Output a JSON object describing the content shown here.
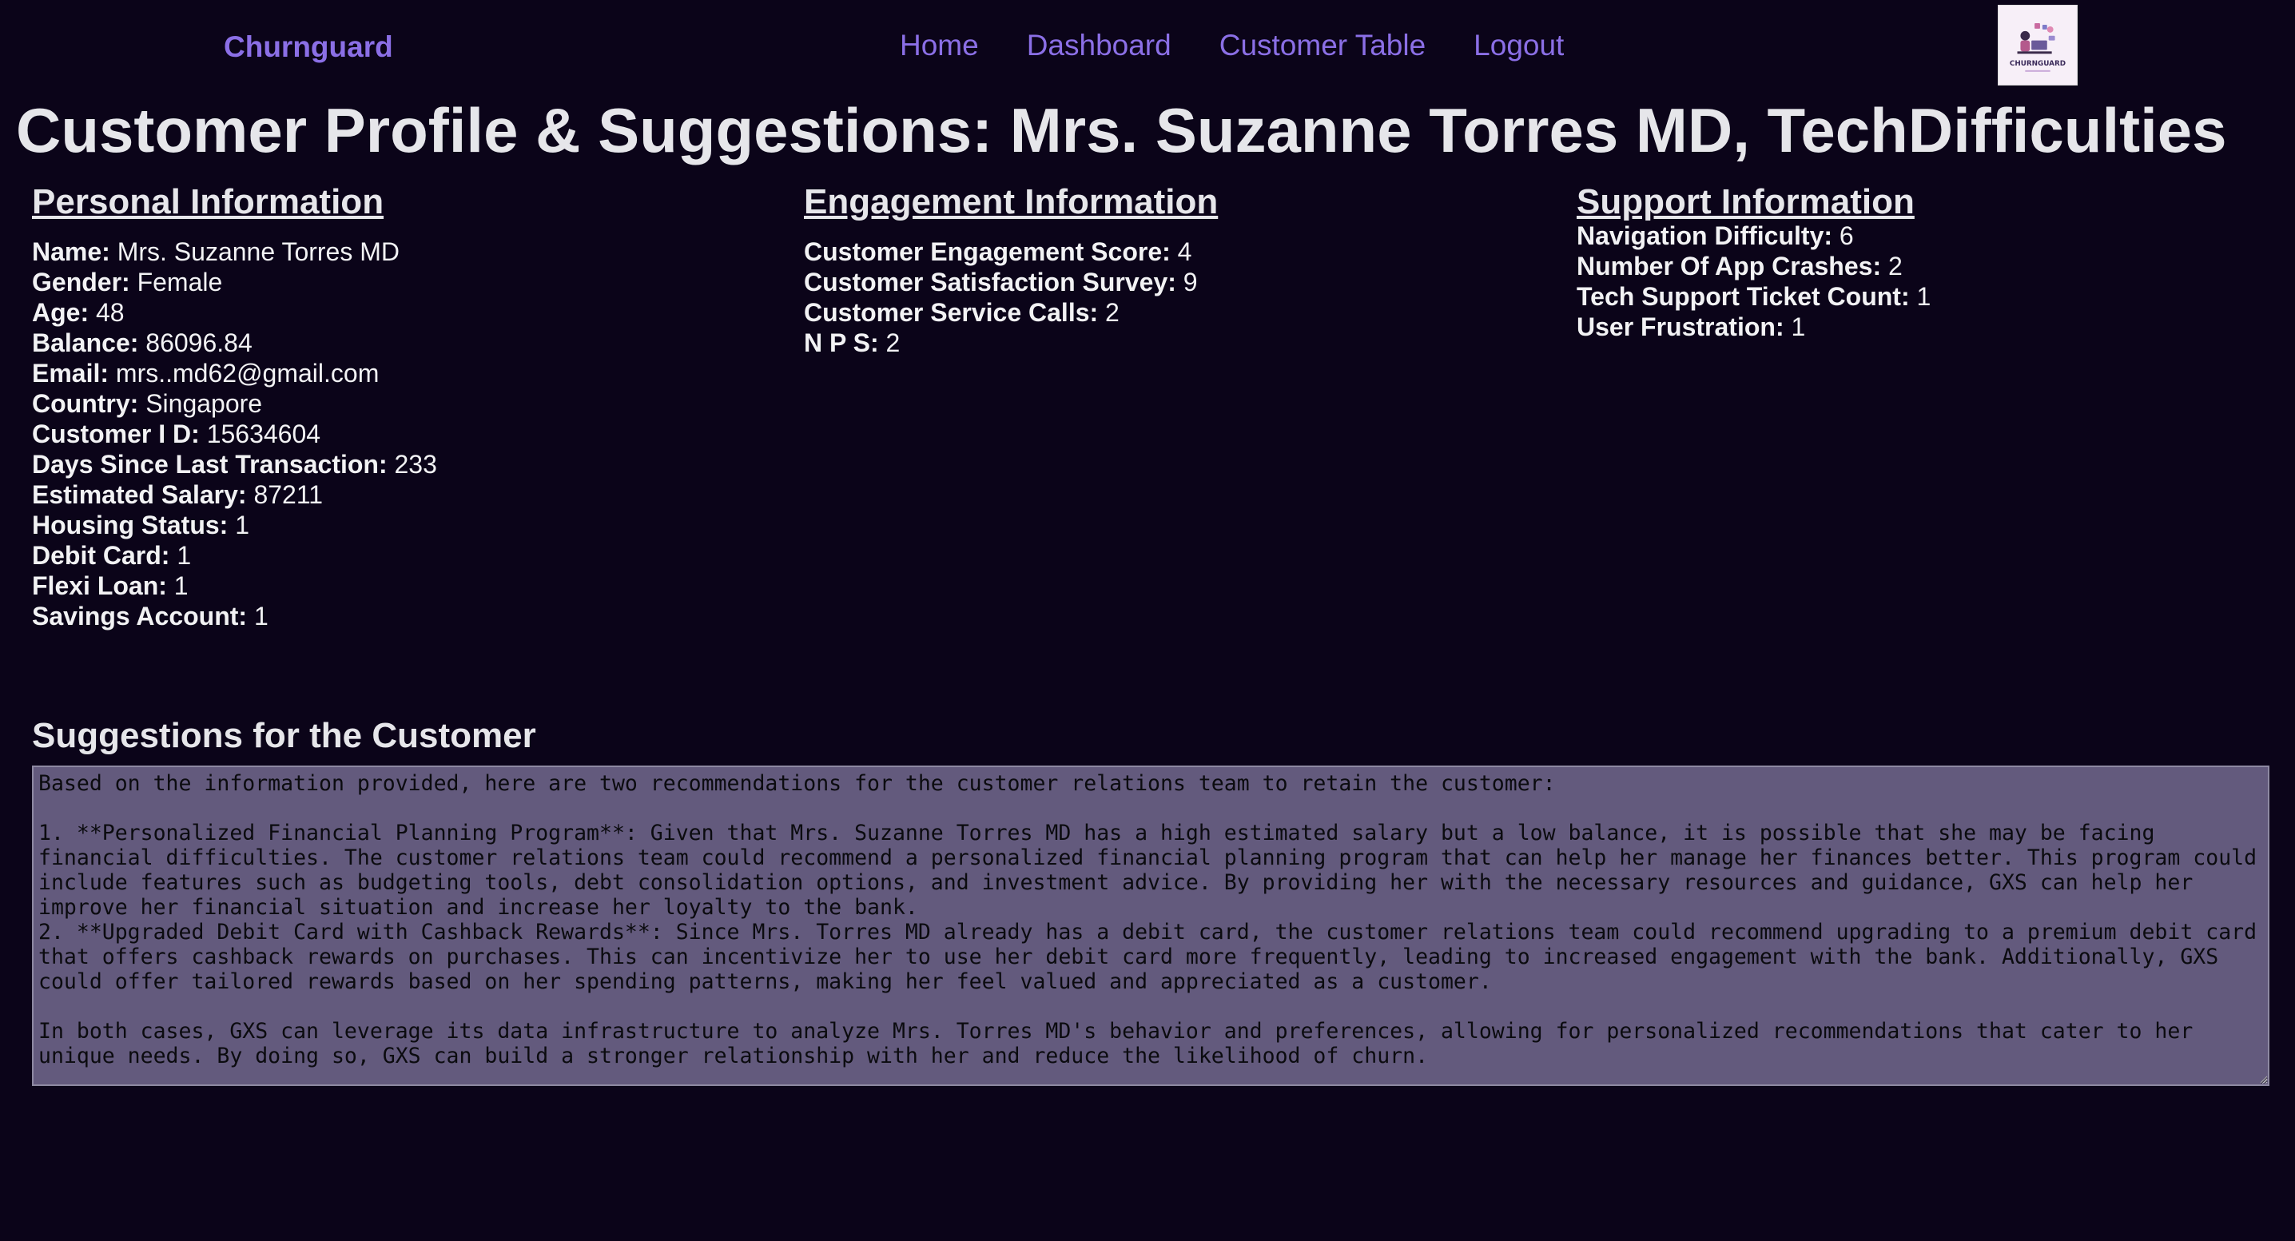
{
  "nav": {
    "brand": "Churnguard",
    "links": [
      "Home",
      "Dashboard",
      "Customer Table",
      "Logout"
    ],
    "logo_text": "CHURNGUARD"
  },
  "page_title": "Customer Profile & Suggestions: Mrs. Suzanne Torres MD, TechDifficulties",
  "personal": {
    "heading": "Personal Information",
    "fields": [
      {
        "label": "Name:",
        "value": "Mrs. Suzanne Torres MD"
      },
      {
        "label": "Gender:",
        "value": "Female"
      },
      {
        "label": "Age:",
        "value": "48"
      },
      {
        "label": "Balance:",
        "value": "86096.84"
      },
      {
        "label": "Email:",
        "value": "mrs..md62@gmail.com"
      },
      {
        "label": "Country:",
        "value": "Singapore"
      },
      {
        "label": "Customer I D:",
        "value": "15634604"
      },
      {
        "label": "Days Since Last Transaction:",
        "value": "233"
      },
      {
        "label": "Estimated Salary:",
        "value": "87211"
      },
      {
        "label": "Housing Status:",
        "value": "1"
      },
      {
        "label": "Debit Card:",
        "value": "1"
      },
      {
        "label": "Flexi Loan:",
        "value": "1"
      },
      {
        "label": "Savings Account:",
        "value": "1"
      }
    ]
  },
  "engagement": {
    "heading": "Engagement Information",
    "fields": [
      {
        "label": "Customer Engagement Score:",
        "value": "4"
      },
      {
        "label": "Customer Satisfaction Survey:",
        "value": "9"
      },
      {
        "label": "Customer Service Calls:",
        "value": "2"
      },
      {
        "label": "N P S:",
        "value": "2"
      }
    ]
  },
  "support": {
    "heading": "Support Information",
    "fields": [
      {
        "label": "Navigation Difficulty:",
        "value": "6"
      },
      {
        "label": "Number Of App Crashes:",
        "value": "2"
      },
      {
        "label": "Tech Support Ticket Count:",
        "value": "1"
      },
      {
        "label": "User Frustration:",
        "value": "1"
      }
    ]
  },
  "suggestions": {
    "heading": "Suggestions for the Customer",
    "text": "Based on the information provided, here are two recommendations for the customer relations team to retain the customer:\n\n1. **Personalized Financial Planning Program**: Given that Mrs. Suzanne Torres MD has a high estimated salary but a low balance, it is possible that she may be facing financial difficulties. The customer relations team could recommend a personalized financial planning program that can help her manage her finances better. This program could include features such as budgeting tools, debt consolidation options, and investment advice. By providing her with the necessary resources and guidance, GXS can help her improve her financial situation and increase her loyalty to the bank.\n2. **Upgraded Debit Card with Cashback Rewards**: Since Mrs. Torres MD already has a debit card, the customer relations team could recommend upgrading to a premium debit card that offers cashback rewards on purchases. This can incentivize her to use her debit card more frequently, leading to increased engagement with the bank. Additionally, GXS could offer tailored rewards based on her spending patterns, making her feel valued and appreciated as a customer.\n\nIn both cases, GXS can leverage its data infrastructure to analyze Mrs. Torres MD's behavior and preferences, allowing for personalized recommendations that cater to her unique needs. By doing so, GXS can build a stronger relationship with her and reduce the likelihood of churn."
  },
  "colors": {
    "background": "#0b0419",
    "accent": "#8b6fe6",
    "textarea_bg": "#635a7d"
  }
}
